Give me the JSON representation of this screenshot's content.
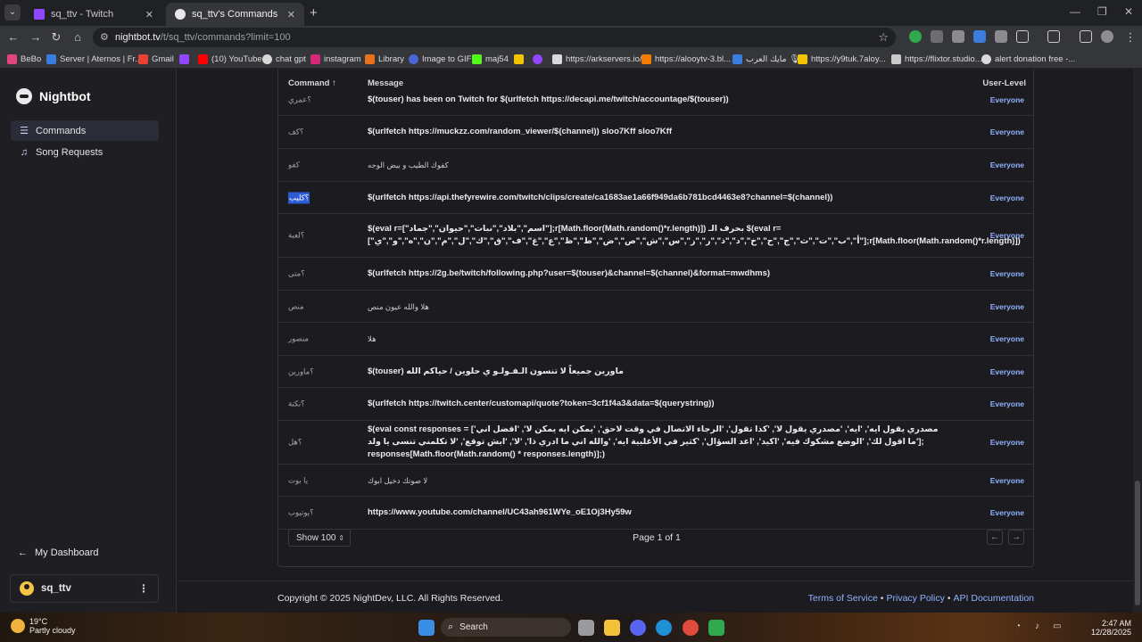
{
  "browser": {
    "tabs": [
      {
        "label": "sq_ttv - Twitch",
        "active": false
      },
      {
        "label": "sq_ttv's Commands",
        "active": true
      }
    ],
    "url_host": "nightbot.tv",
    "url_path": "/t/sq_ttv/commands?limit=100",
    "bookmarks": [
      {
        "label": "BeBo",
        "color": "#e0457b"
      },
      {
        "label": "Server | Aternos | Fr...",
        "color": "#3b7ddd"
      },
      {
        "label": "Gmail",
        "color": "#ea4335"
      },
      {
        "label": "",
        "color": "#9146ff"
      },
      {
        "label": "(10) YouTube",
        "color": "#ff0000"
      },
      {
        "label": "chat gpt",
        "color": "#d9d9d9"
      },
      {
        "label": "instagram",
        "color": "#d62976"
      },
      {
        "label": "Library",
        "color": "#e8711a"
      },
      {
        "label": "Image to GIF",
        "color": "#4a66d8"
      },
      {
        "label": "maj54",
        "color": "#53fc18"
      },
      {
        "label": "",
        "color": "#f5c400"
      },
      {
        "label": "",
        "color": "#9146ff"
      },
      {
        "label": "https://arkservers.io/",
        "color": "#d9d9d9"
      },
      {
        "label": "https://alooytv-3.bl...",
        "color": "#f57c00"
      },
      {
        "label": "مايك العرب 🎙",
        "color": "#3b7ddd"
      },
      {
        "label": "https://y9tuk.7aloy...",
        "color": "#f5c400"
      },
      {
        "label": "https://flixtor.studio...",
        "color": "#c9c9c9"
      },
      {
        "label": "alert donation free -...",
        "color": "#d9d9d9"
      }
    ]
  },
  "sidebar": {
    "brand": "Nightbot",
    "items": [
      {
        "label": "Commands",
        "icon": "list-icon",
        "active": true
      },
      {
        "label": "Song Requests",
        "icon": "headphones-icon",
        "active": false
      }
    ],
    "dashboard_link": "My Dashboard",
    "username": "sq_ttv"
  },
  "table": {
    "headers": {
      "command": "Command ↑",
      "message": "Message",
      "level": "User-Level"
    },
    "rows": [
      {
        "command": "؟عمري",
        "message": "$(touser) has been on Twitch for $(urlfetch https://decapi.me/twitch/accountage/$(touser))",
        "level": "Everyone",
        "ar": false,
        "selected": false
      },
      {
        "command": "؟كف",
        "message": "$(urlfetch https://muckzz.com/random_viewer/$(channel)) sloo7Kff sloo7Kff",
        "level": "Everyone",
        "ar": false,
        "selected": false
      },
      {
        "command": "كفو",
        "message": "كفوك الطيب و بيض الوجه",
        "level": "Everyone",
        "ar": true,
        "selected": false
      },
      {
        "command": "؟كليب",
        "message": "$(urlfetch https://api.thefyrewire.com/twitch/clips/create/ca1683ae1a66f949da6b781bcd4463e8?channel=$(channel))",
        "level": "Everyone",
        "ar": false,
        "selected": true
      },
      {
        "command": "؟لعبة",
        "message": "$(eval r=[\"اسم\",\"بلاد\",\"نبات\",\"حيوان\",\"جماد\"];r[Math.floor(Math.random()*r.length)]) بحرف الـ $(eval r=[\"أ\",\"ب\",\"ت\",\"ث\",\"ج\",\"ح\",\"خ\",\"د\",\"ذ\",\"ر\",\"ز\",\"س\",\"ش\",\"ص\",\"ض\",\"ط\",\"ظ\",\"ع\",\"غ\",\"ف\",\"ق\",\"ك\",\"ل\",\"م\",\"ن\",\"ه\",\"و\",\"ي\"];r[Math.floor(Math.random()*r.length)])",
        "level": "Everyone",
        "ar": false,
        "selected": false
      },
      {
        "command": "؟متى",
        "message": "$(urlfetch https://2g.be/twitch/following.php?user=$(touser)&channel=$(channel)&format=mwdhms)",
        "level": "Everyone",
        "ar": false,
        "selected": false
      },
      {
        "command": "منص",
        "message": "هلا والله عيون منص",
        "level": "Everyone",
        "ar": true,
        "selected": false
      },
      {
        "command": "منصور",
        "message": "هلا",
        "level": "Everyone",
        "ar": true,
        "selected": false
      },
      {
        "command": "؟ماورين",
        "message": "$(touser) ماورين جميعاً لا تنسون الـفـولـو ي حلوين / حياكم الله",
        "level": "Everyone",
        "ar": false,
        "selected": false
      },
      {
        "command": "؟نكتة",
        "message": "$(urlfetch https://twitch.center/customapi/quote?token=3cf1f4a3&data=$(querystring))",
        "level": "Everyone",
        "ar": false,
        "selected": false
      },
      {
        "command": "؟هل",
        "message": "$(eval const responses = ['مصدري يقول ايه', 'ايه', 'مصدري يقول لا', 'كذا تقول', 'الرجاء الاتصال في وقت لاحق', 'يمكن ايه يمكن لا', 'افضل اني ما اقول لك', 'الوضع مشكوك فيه', 'اكيد', 'اعد السؤال', 'كثير في الأغلبية ايه', 'والله اني ما ادري ذا', 'لا', 'ابش توقع', 'لا تكلمني تنسى يا ولد']; responses[Math.floor(Math.random() * responses.length)];)",
        "level": "Everyone",
        "ar": false,
        "selected": false
      },
      {
        "command": "يا بوت",
        "message": "لا صوتك دخيل ابوك",
        "level": "Everyone",
        "ar": true,
        "selected": false
      },
      {
        "command": "؟يوتيوب",
        "message": "https://www.youtube.com/channel/UC43ah961WYe_oE1Oj3Hy59w",
        "level": "Everyone",
        "ar": false,
        "selected": false
      }
    ],
    "show_label": "Show 100",
    "page_info": "Page 1 of 1"
  },
  "footer": {
    "copyright": "Copyright © 2025 NightDev, LLC. All Rights Reserved.",
    "links": [
      "Terms of Service",
      "Privacy Policy",
      "API Documentation"
    ]
  },
  "taskbar": {
    "temp": "19°C",
    "weather": "Partly cloudy",
    "search": "Search",
    "time": "2:47 AM",
    "date": "12/28/2025"
  }
}
